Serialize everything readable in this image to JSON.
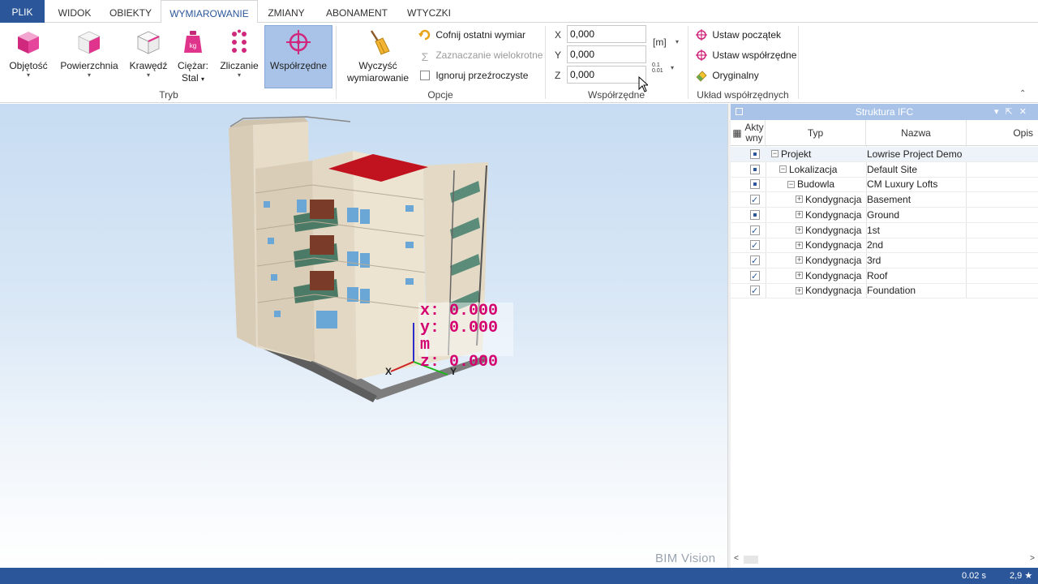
{
  "tabs": [
    {
      "label": "PLIK"
    },
    {
      "label": "WIDOK"
    },
    {
      "label": "OBIEKTY"
    },
    {
      "label": "WYMIAROWANIE"
    },
    {
      "label": "ZMIANY"
    },
    {
      "label": "ABONAMENT"
    },
    {
      "label": "WTYCZKI"
    }
  ],
  "ribbon": {
    "tryb": {
      "group_label": "Tryb",
      "objetosc": "Objętość",
      "powierzchnia": "Powierzchnia",
      "krawedz": "Krawędź",
      "ciezar_line1": "Ciężar:",
      "ciezar_line2": "Stal",
      "zliczanie": "Zliczanie",
      "wspolrzedne": "Współrzędne"
    },
    "opcje": {
      "group_label": "Opcje",
      "wyczysc_line1": "Wyczyść",
      "wyczysc_line2": "wymiarowanie",
      "cofnij": "Cofnij ostatni wymiar",
      "zaznaczanie": "Zaznaczanie wielokrotne",
      "ignoruj": "Ignoruj przeźroczyste"
    },
    "wspolrzedne": {
      "group_label": "Współrzędne",
      "x_label": "X",
      "x_value": "0,000",
      "y_label": "Y",
      "y_value": "0,000",
      "z_label": "Z",
      "z_value": "0,000",
      "unit": "[m]",
      "precision_top": "0.1",
      "precision_bottom": "0.01"
    },
    "uklad": {
      "group_label": "Układ współrzędnych",
      "ustaw_poczatek": "Ustaw początek",
      "ustaw_wspolrzedne": "Ustaw współrzędne",
      "oryginalny": "Oryginalny"
    }
  },
  "viewport": {
    "overlay_x": "x: 0.000",
    "overlay_y": "y: 0.000 m",
    "overlay_z": "z: 0.000",
    "axis_x": "X",
    "axis_y": "Y",
    "watermark": "BIM Vision"
  },
  "ifc_panel": {
    "title": "Struktura IFC",
    "columns": {
      "aktywny_1": "Akty",
      "aktywny_2": "wny",
      "typ": "Typ",
      "nazwa": "Nazwa",
      "opis": "Opis"
    },
    "rows": [
      {
        "typ": "Projekt",
        "nazwa": "Lowrise Project Demo",
        "level": 0,
        "state": "partial",
        "toggle": "⊟"
      },
      {
        "typ": "Lokalizacja",
        "nazwa": "Default Site",
        "level": 1,
        "state": "partial",
        "toggle": "⊟"
      },
      {
        "typ": "Budowla",
        "nazwa": "CM Luxury Lofts",
        "level": 2,
        "state": "partial",
        "toggle": "⊟"
      },
      {
        "typ": "Kondygnacja",
        "nazwa": "Basement",
        "level": 3,
        "state": "checked",
        "toggle": "⊞"
      },
      {
        "typ": "Kondygnacja",
        "nazwa": "Ground",
        "level": 3,
        "state": "partial",
        "toggle": "⊞"
      },
      {
        "typ": "Kondygnacja",
        "nazwa": "1st",
        "level": 3,
        "state": "checked",
        "toggle": "⊞"
      },
      {
        "typ": "Kondygnacja",
        "nazwa": "2nd",
        "level": 3,
        "state": "checked",
        "toggle": "⊞"
      },
      {
        "typ": "Kondygnacja",
        "nazwa": "3rd",
        "level": 3,
        "state": "checked",
        "toggle": "⊞"
      },
      {
        "typ": "Kondygnacja",
        "nazwa": "Roof",
        "level": 3,
        "state": "checked",
        "toggle": "⊞"
      },
      {
        "typ": "Kondygnacja",
        "nazwa": "Foundation",
        "level": 3,
        "state": "checked",
        "toggle": "⊞"
      }
    ]
  },
  "statusbar": {
    "time": "0.02 s",
    "fps": "2,9 ★"
  },
  "colors": {
    "accent": "#2b579a",
    "active_tool": "#a9c3e8",
    "overlay_text": "#d4006f"
  }
}
